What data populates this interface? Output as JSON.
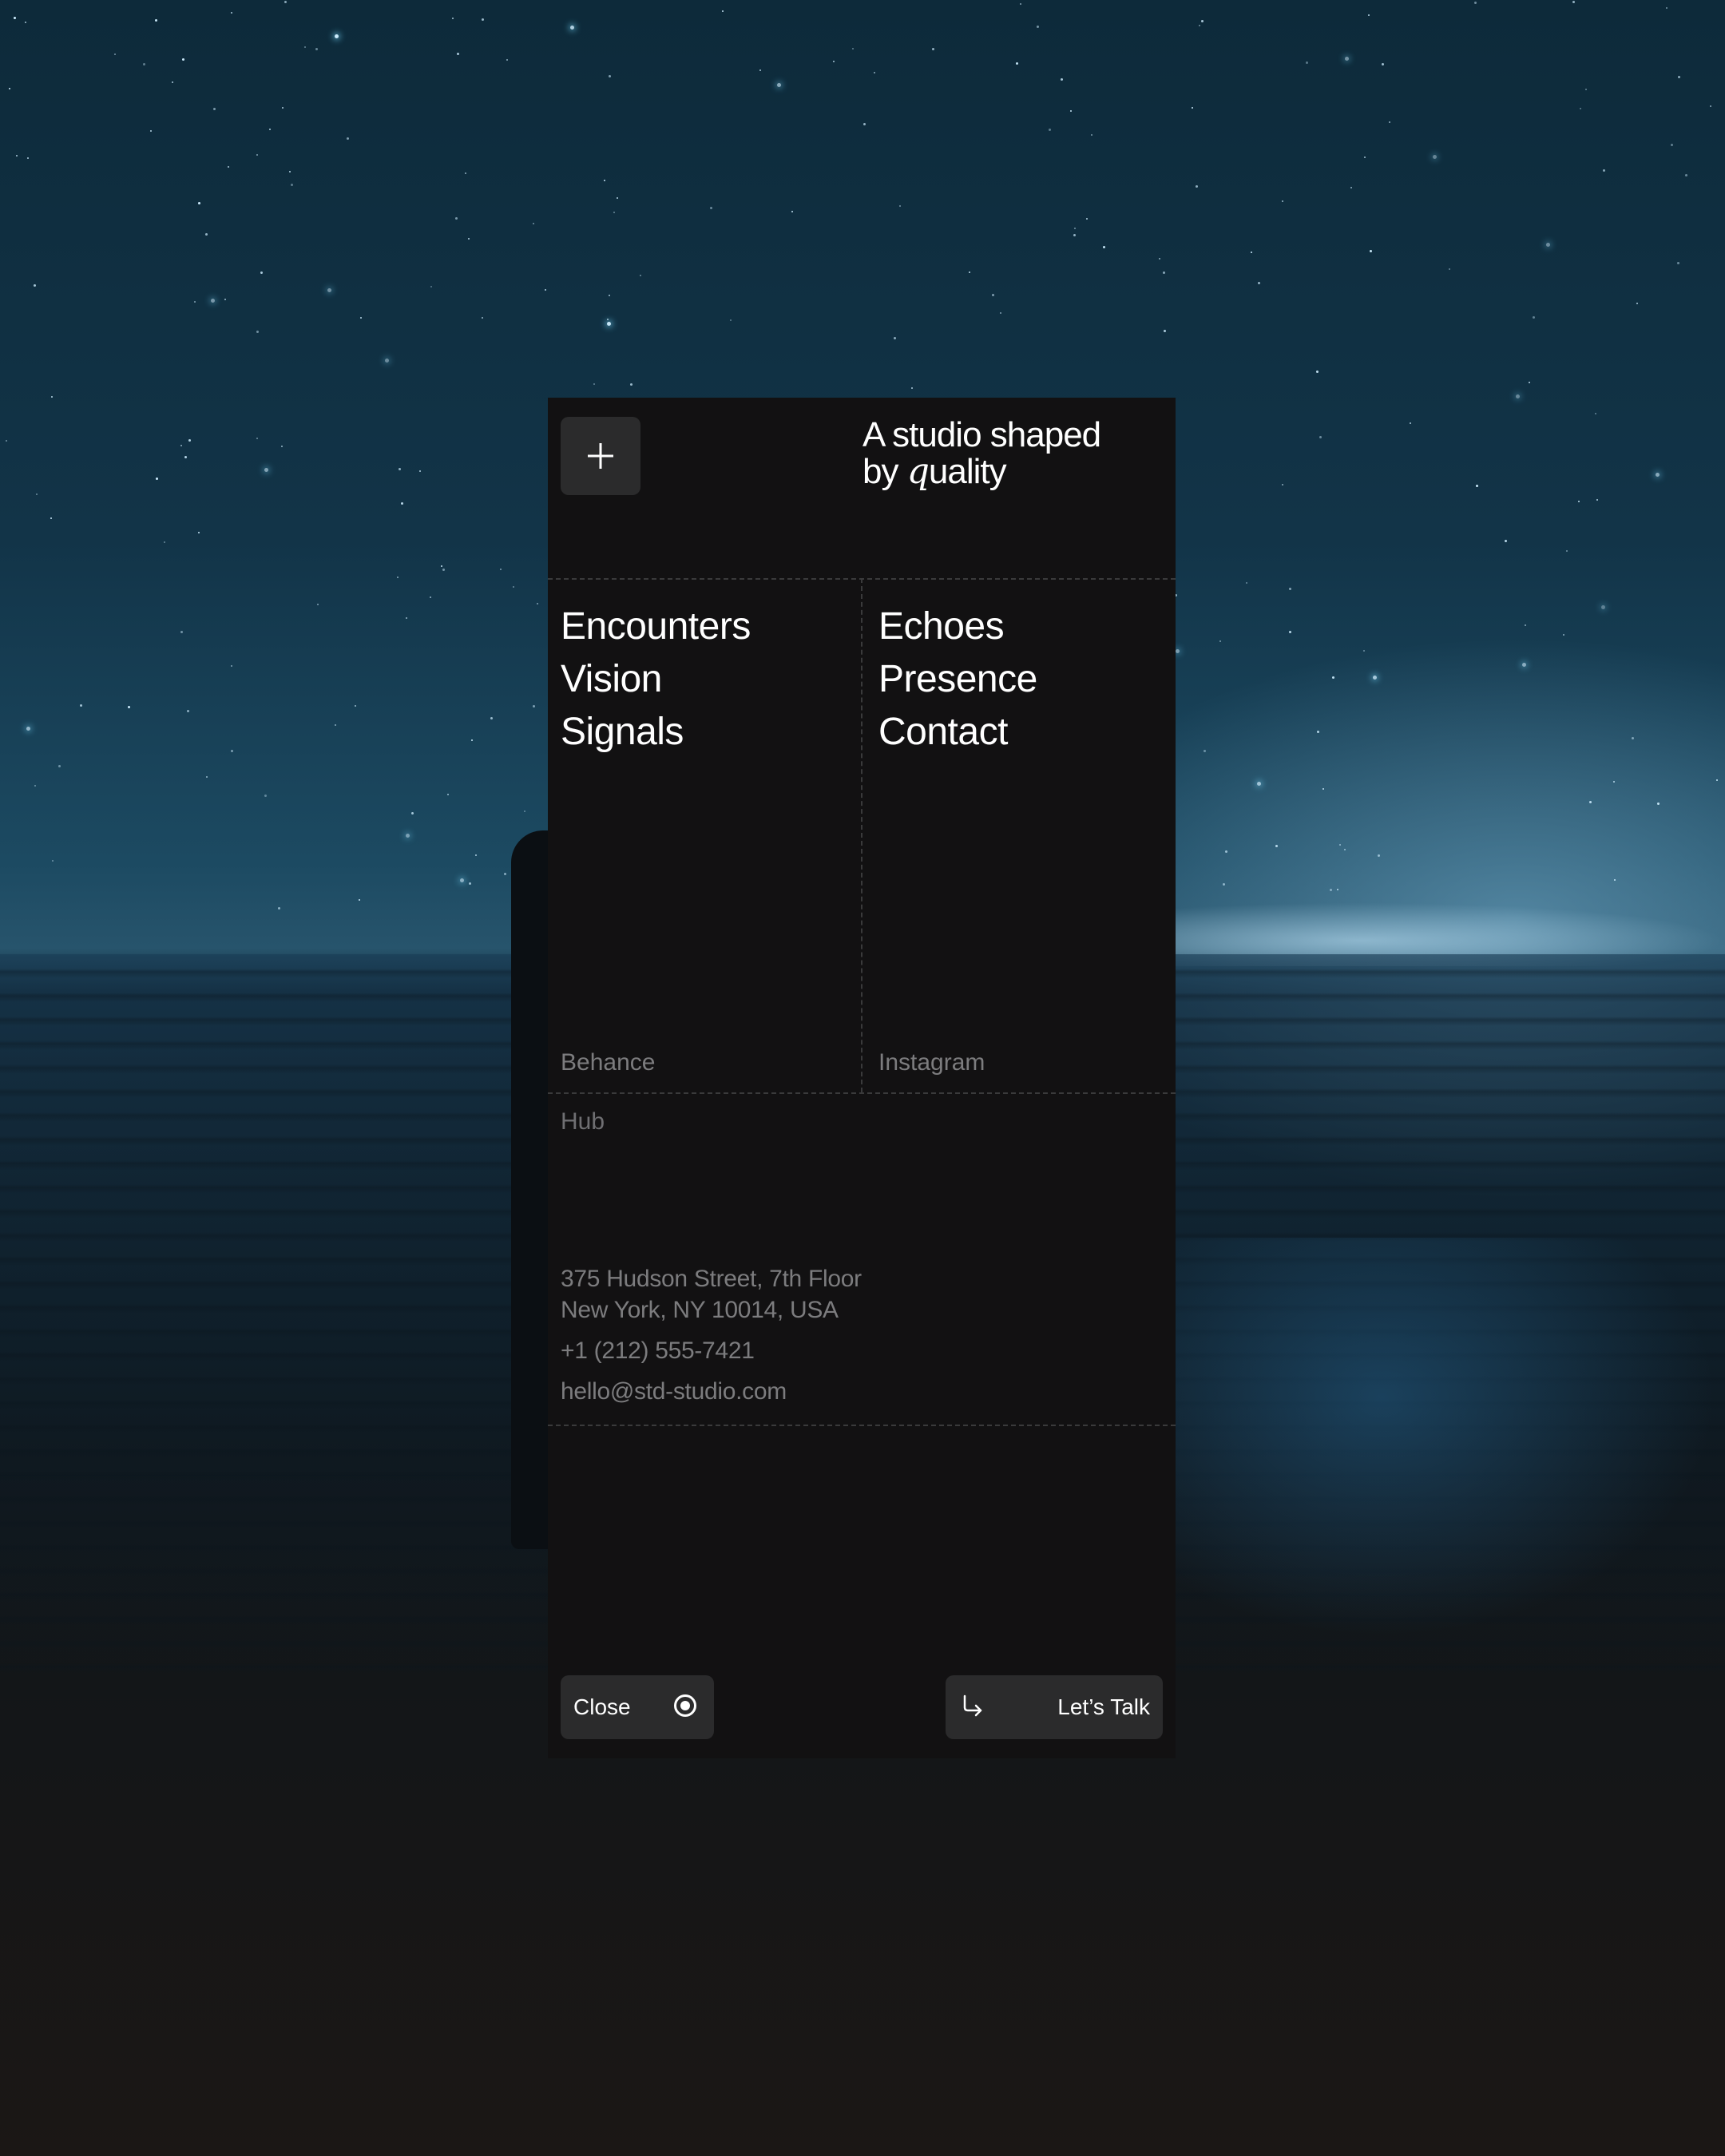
{
  "header": {
    "menu_icon": "plus-icon",
    "tagline_line1": "A studio shaped",
    "tagline_line2_prefix": "by ",
    "tagline_line2_accent": "q",
    "tagline_line2_suffix": "uality"
  },
  "nav": {
    "left": [
      "Encounters",
      "Vision",
      "Signals"
    ],
    "right": [
      "Echoes",
      "Presence",
      "Contact"
    ]
  },
  "social": {
    "left": "Behance",
    "right": "Instagram"
  },
  "hub": {
    "label": "Hub",
    "address_line1": "375 Hudson Street, 7th Floor",
    "address_line2": "New York, NY 10014, USA",
    "phone": "+1 (212) 555-7421",
    "email": "hello@std-studio.com"
  },
  "footer": {
    "close_label": "Close",
    "close_icon": "radio-dot-icon",
    "talk_label": "Let’s Talk",
    "talk_icon": "arrow-down-right-icon"
  },
  "colors": {
    "panel": "#121112",
    "button": "#2b2b2c",
    "muted_text": "#7c7c7e",
    "text": "#ffffff"
  }
}
